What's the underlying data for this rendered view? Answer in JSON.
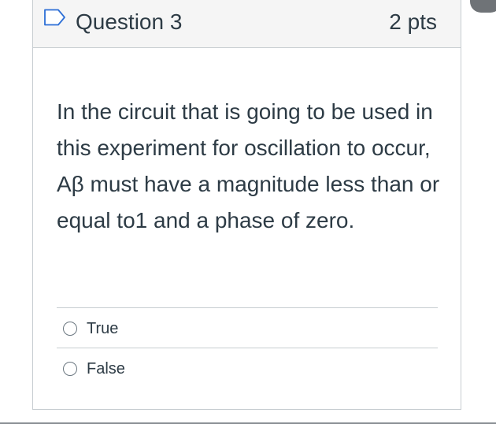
{
  "question": {
    "title": "Question 3",
    "points": "2 pts",
    "flag_icon": "flag-outline-icon",
    "text": "In the circuit that is going to be used in this experiment for oscillation to occur, Aβ must have a magnitude less than or equal to1 and a phase of zero."
  },
  "answers": [
    {
      "label": "True",
      "selected": false
    },
    {
      "label": "False",
      "selected": false
    }
  ],
  "colors": {
    "text": "#2d3b45",
    "border": "#c7cdd1",
    "header_bg": "#f5f5f5"
  }
}
